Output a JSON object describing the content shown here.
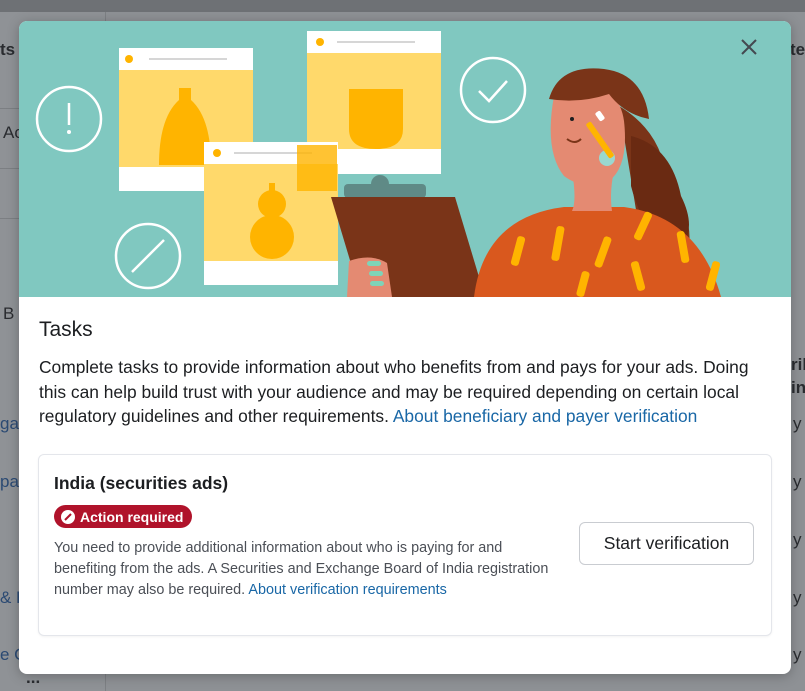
{
  "background": {
    "fragments": [
      "ts",
      "ted",
      "Ac",
      "B",
      "ga",
      "pa",
      "& H",
      "e C",
      "rib",
      "in",
      "y",
      "y",
      "y",
      "y",
      "y",
      "..."
    ]
  },
  "modal": {
    "title": "Tasks",
    "close_icon": "close-icon",
    "description": "Complete tasks to provide information about who benefits from and pays for your ads. Doing this can help build trust with your audience and may be required depending on certain local regulatory guidelines and other requirements.",
    "description_link": "About beneficiary and payer verification",
    "task": {
      "title": "India (securities ads)",
      "badge": "Action required",
      "badge_icon": "prohibited-icon",
      "badge_color": "#b0132b",
      "text": "You need to provide additional information about who is paying for and benefiting from the ads. A Securities and Exchange Board of India registration number may also be required.",
      "text_link": "About verification requirements",
      "button": "Start verification"
    }
  },
  "colors": {
    "hero_background": "#80c8c0",
    "link": "#1967a6"
  }
}
